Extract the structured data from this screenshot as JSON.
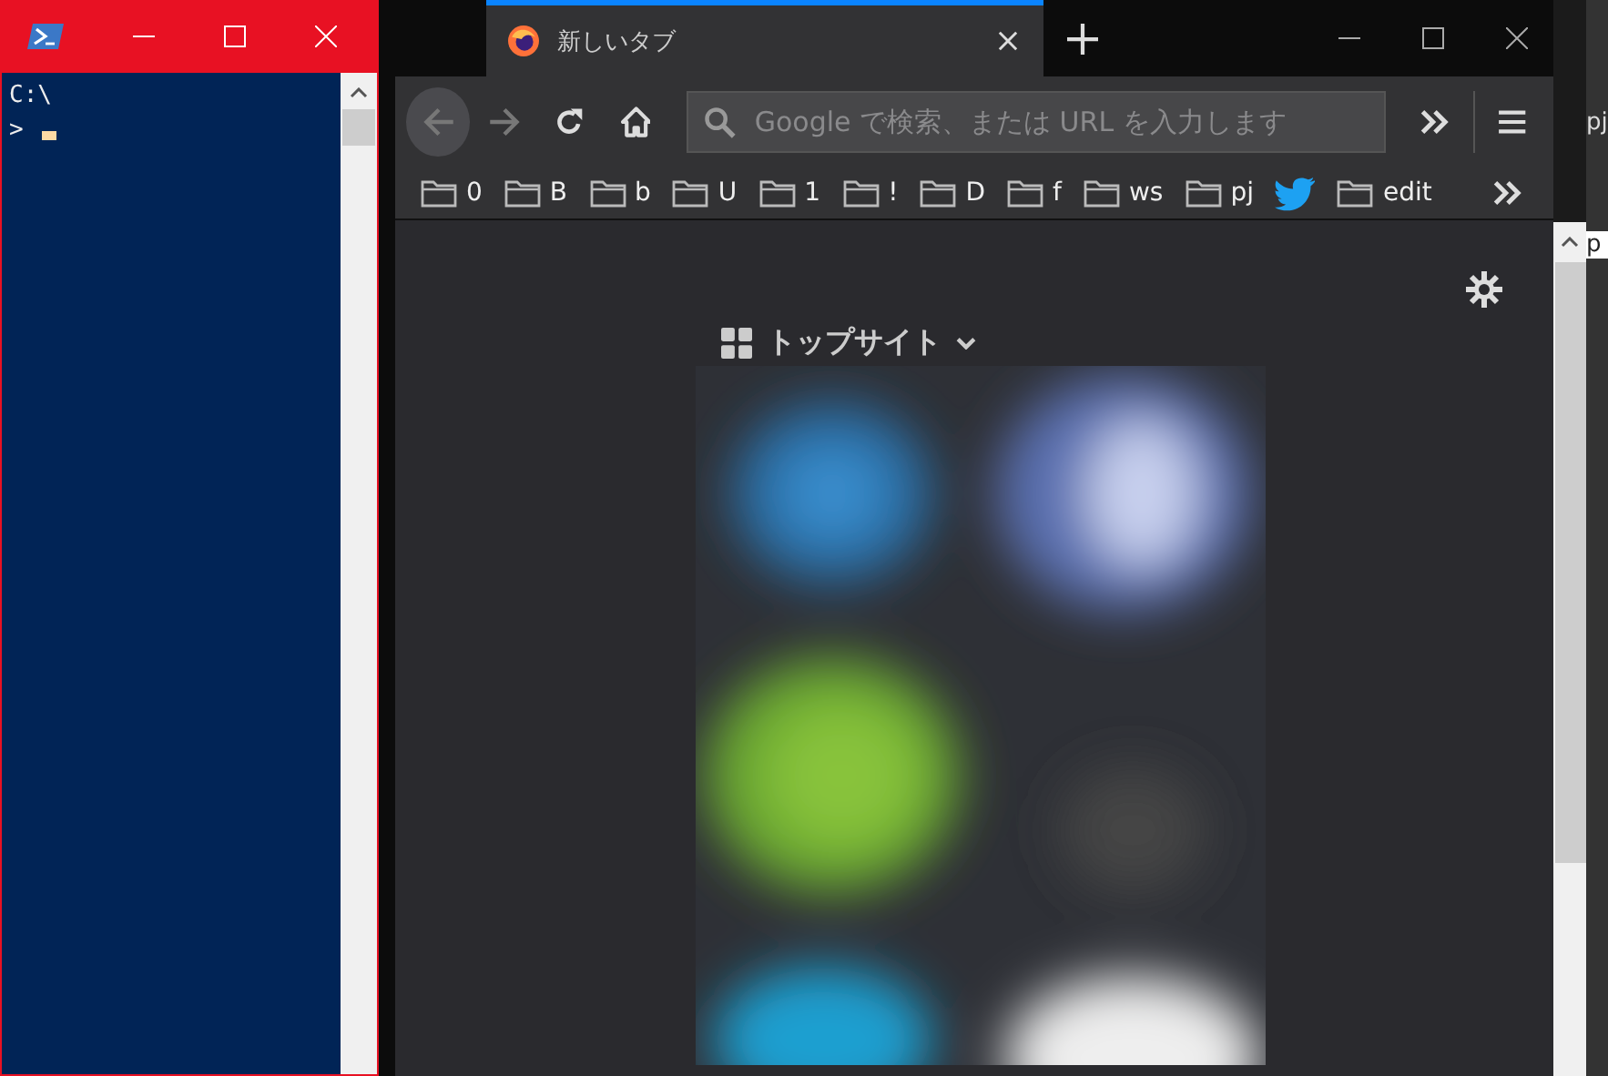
{
  "powershell": {
    "lines": [
      "C:\\",
      ">"
    ]
  },
  "firefox": {
    "tabs": [
      {
        "title": "新しいタブ",
        "selected": true
      }
    ],
    "nav": {
      "back_disabled": true,
      "forward_disabled": true
    },
    "url_placeholder": "Google で検索、または URL を入力します",
    "bookmarks": [
      {
        "kind": "folder",
        "label": "0"
      },
      {
        "kind": "folder",
        "label": "B"
      },
      {
        "kind": "folder",
        "label": "b"
      },
      {
        "kind": "folder",
        "label": "U"
      },
      {
        "kind": "folder",
        "label": "1"
      },
      {
        "kind": "folder",
        "label": "!"
      },
      {
        "kind": "folder",
        "label": "D"
      },
      {
        "kind": "folder",
        "label": "f"
      },
      {
        "kind": "folder",
        "label": "ws"
      },
      {
        "kind": "folder",
        "label": "pj"
      },
      {
        "kind": "bird"
      },
      {
        "kind": "folder",
        "label": "edit"
      }
    ],
    "top_sites": {
      "title": "トップサイト",
      "expanded": true
    }
  },
  "background_window": {
    "texts": [
      "pj",
      "p"
    ]
  }
}
